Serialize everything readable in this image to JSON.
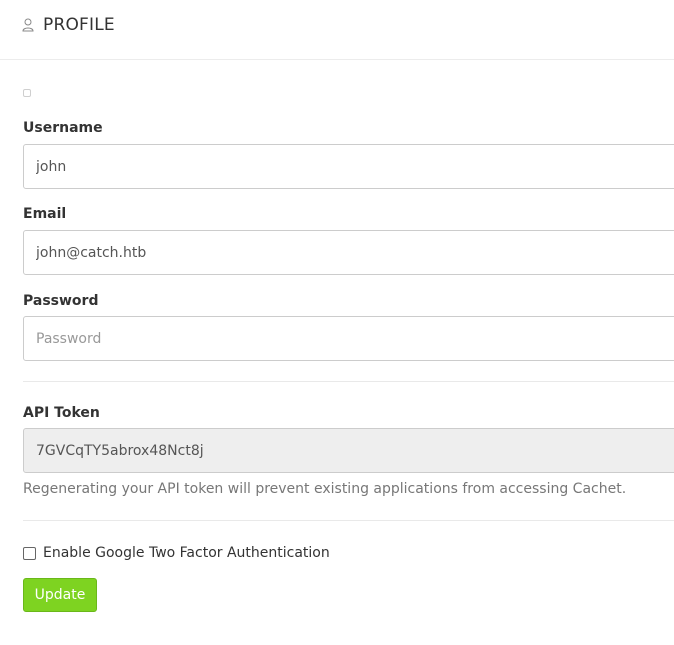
{
  "header": {
    "title": "PROFILE",
    "icon": "user-icon"
  },
  "form": {
    "username": {
      "label": "Username",
      "value": "john"
    },
    "email": {
      "label": "Email",
      "value": "john@catch.htb"
    },
    "password": {
      "label": "Password",
      "value": "",
      "placeholder": "Password"
    },
    "api_token": {
      "label": "API Token",
      "value": "7GVCqTY5abrox48Nct8j",
      "help": "Regenerating your API token will prevent existing applications from accessing Cachet."
    },
    "two_factor": {
      "label": "Enable Google Two Factor Authentication",
      "checked": false
    },
    "submit_label": "Update"
  },
  "colors": {
    "accent": "#7ed321",
    "border": "#cccccc",
    "readonly_bg": "#eeeeee"
  }
}
